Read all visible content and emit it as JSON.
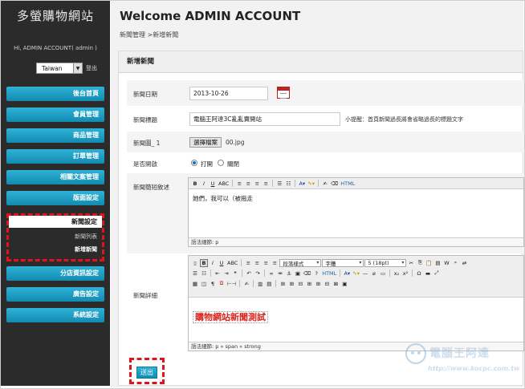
{
  "sidebar": {
    "brand": "多螢購物網站",
    "greeting": "Hi, ADMIN ACCOUNT( admin )",
    "language": "Taiwan",
    "logout": "登出",
    "nav_top": [
      "後台首頁",
      "會員管理",
      "商品管理",
      "訂單管理",
      "相關文案管理",
      "版面設定"
    ],
    "submenu": {
      "title": "新聞設定",
      "items": [
        "新聞列表",
        "新增新聞"
      ]
    },
    "nav_bottom": [
      "分店資訊設定",
      "廣告設定",
      "系統設定"
    ]
  },
  "header": {
    "title": "Welcome ADMIN ACCOUNT",
    "breadcrumb": "新聞管理 >新增新聞"
  },
  "panel": {
    "title": "新增新聞",
    "date_label": "新聞日期",
    "date_value": "2013-10-26",
    "title_label": "新聞標題",
    "title_value": "電腦王阿達3C亂亂賣開站",
    "title_hint": "小提醒：首頁新聞過長將會省略過長的標題文字",
    "image_label": "新聞圖_ 1",
    "file_button": "選擇檔案",
    "file_name": "00.jpg",
    "open_label": "是否開啟",
    "open_on": "打開",
    "open_off": "關閉",
    "summary_label": "新聞簡短敘述",
    "summary_text": "她們，我可以（被拖走",
    "summary_status": "語法細節: p",
    "detail_label": "新聞詳細",
    "detail_text": "購物網站新聞測試",
    "detail_status": "語法細節: p » span » strong",
    "format_dropdown": "段落樣式",
    "font_dropdown": "字體",
    "size_dropdown": "5 (18pt)",
    "submit": "送出"
  },
  "watermark": {
    "title": "電腦王阿達",
    "url": "http://www.kocpc.com.tw"
  },
  "colors": {
    "sidebar_bg": "#2b2b2b",
    "nav_button": "#1ea2c8",
    "highlight_dash": "#e1141e",
    "detail_text": "#d8261d"
  }
}
